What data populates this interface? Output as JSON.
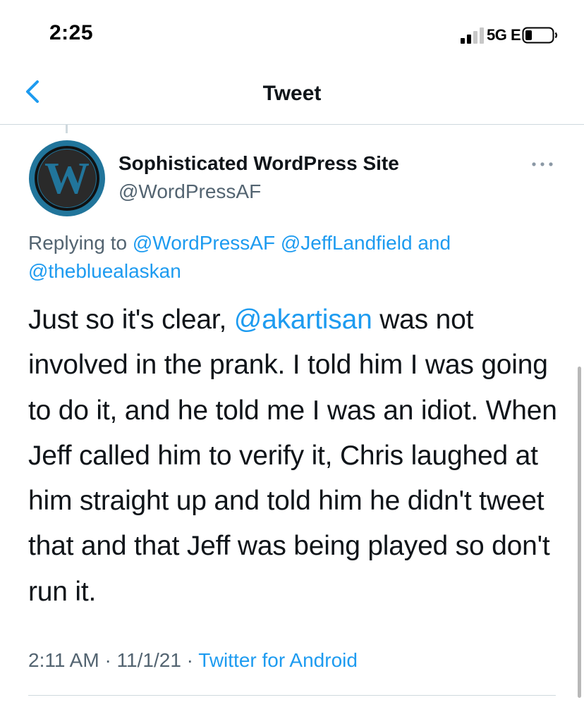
{
  "status_bar": {
    "time": "2:25",
    "network": "5G E",
    "icons": [
      "signal-bars-icon",
      "battery-icon"
    ]
  },
  "nav": {
    "title": "Tweet",
    "back_icon": "chevron-left-icon"
  },
  "tweet": {
    "author_name": "Sophisticated WordPress Site",
    "author_handle": "@WordPressAF",
    "avatar_icon": "wordpress-logo",
    "more_icon": "more-options-icon",
    "replying_to": {
      "prefix": "Replying to",
      "mentions": [
        "@WordPressAF",
        "@JeffLandfield",
        "@thebluealaskan"
      ],
      "conjunction": "and"
    },
    "text": {
      "before_mention": "Just so it's clear, ",
      "mention": "@akartisan",
      "after_mention": " was not involved in the prank. I told him I was going to do it, and he told me I was an idiot. When Jeff called him to verify it, Chris laughed at him straight up and told him he didn't tweet that and that Jeff was being played so don't run it."
    },
    "time": "2:11 AM",
    "date": "11/1/21",
    "separator": "·",
    "source": "Twitter for Android"
  },
  "colors": {
    "accent": "#1d9bf0",
    "secondary_text": "#536471",
    "primary_text": "#0f1419",
    "divider": "#cfd9de",
    "avatar_bg": "#21759b"
  }
}
